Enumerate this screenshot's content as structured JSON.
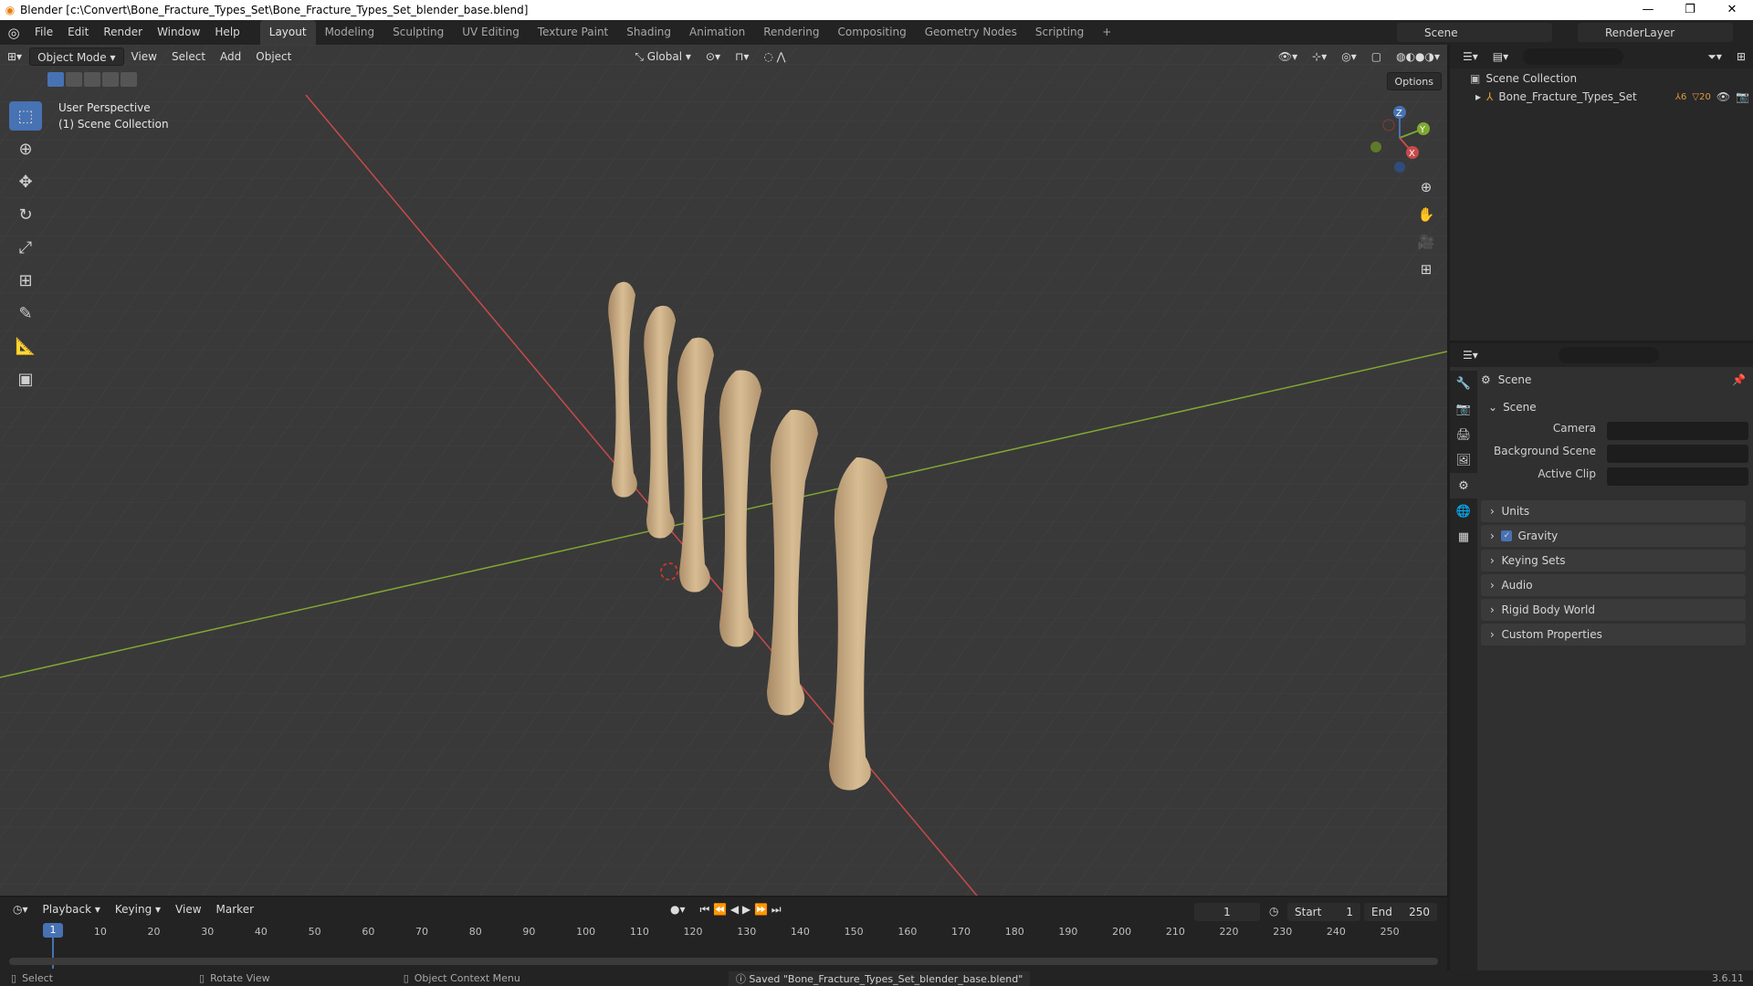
{
  "window": {
    "title": "Blender [c:\\Convert\\Bone_Fracture_Types_Set\\Bone_Fracture_Types_Set_blender_base.blend]"
  },
  "menus": [
    "File",
    "Edit",
    "Render",
    "Window",
    "Help"
  ],
  "workspaces": [
    "Layout",
    "Modeling",
    "Sculpting",
    "UV Editing",
    "Texture Paint",
    "Shading",
    "Animation",
    "Rendering",
    "Compositing",
    "Geometry Nodes",
    "Scripting",
    "+"
  ],
  "scene_selector": {
    "value": "Scene"
  },
  "renderlayer_selector": {
    "value": "RenderLayer"
  },
  "viewport": {
    "mode": "Object Mode",
    "menus": [
      "View",
      "Select",
      "Add",
      "Object"
    ],
    "transform": "Global",
    "options_label": "Options",
    "info_line1": "User Perspective",
    "info_line2": "(1) Scene Collection"
  },
  "outliner": {
    "root": "Scene Collection",
    "items": [
      {
        "name": "Bone_Fracture_Types_Set",
        "badge1": "6",
        "badge2": "20"
      }
    ]
  },
  "properties": {
    "header": "Scene",
    "panel_title": "Scene",
    "fields": [
      {
        "label": "Camera",
        "value": ""
      },
      {
        "label": "Background Scene",
        "value": ""
      },
      {
        "label": "Active Clip",
        "value": ""
      }
    ],
    "subpanels": [
      "Units",
      "Gravity",
      "Keying Sets",
      "Audio",
      "Rigid Body World",
      "Custom Properties"
    ],
    "gravity_checked": true
  },
  "timeline": {
    "menus": [
      "Playback",
      "Keying",
      "View",
      "Marker"
    ],
    "current_frame": "1",
    "start_label": "Start",
    "start": "1",
    "end_label": "End",
    "end": "250",
    "ticks": [
      "1",
      "10",
      "20",
      "30",
      "40",
      "50",
      "60",
      "70",
      "80",
      "90",
      "100",
      "110",
      "120",
      "130",
      "140",
      "150",
      "160",
      "170",
      "180",
      "190",
      "200",
      "210",
      "220",
      "230",
      "240",
      "250"
    ]
  },
  "status": {
    "select": "Select",
    "rotate": "Rotate View",
    "context": "Object Context Menu",
    "message": "Saved \"Bone_Fracture_Types_Set_blender_base.blend\"",
    "version": "3.6.11"
  },
  "colors": {
    "accent": "#4772b3",
    "x_axis": "#c84a4a",
    "y_axis": "#7fa832",
    "bone": "#d2b48c"
  }
}
